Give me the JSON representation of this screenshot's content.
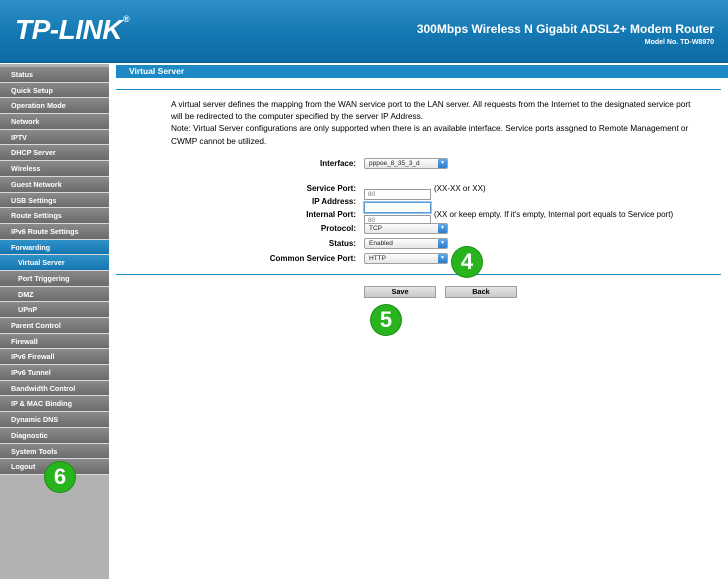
{
  "header": {
    "brand": "TP-LINK",
    "title": "300Mbps Wireless N Gigabit ADSL2+ Modem Router",
    "model": "Model No. TD-W8970"
  },
  "sidebar": {
    "items": [
      {
        "label": "Status"
      },
      {
        "label": "Quick Setup"
      },
      {
        "label": "Operation Mode"
      },
      {
        "label": "Network"
      },
      {
        "label": "IPTV"
      },
      {
        "label": "DHCP Server"
      },
      {
        "label": "Wireless"
      },
      {
        "label": "Guest Network"
      },
      {
        "label": "USB Settings"
      },
      {
        "label": "Route Settings"
      },
      {
        "label": "IPv6 Route Settings"
      },
      {
        "label": "Forwarding"
      },
      {
        "label": "Virtual Server"
      },
      {
        "label": "Port Triggering"
      },
      {
        "label": "DMZ"
      },
      {
        "label": "UPnP"
      },
      {
        "label": "Parent Control"
      },
      {
        "label": "Firewall"
      },
      {
        "label": "IPv6 Firewall"
      },
      {
        "label": "IPv6 Tunnel"
      },
      {
        "label": "Bandwidth Control"
      },
      {
        "label": "IP & MAC Binding"
      },
      {
        "label": "Dynamic DNS"
      },
      {
        "label": "Diagnostic"
      },
      {
        "label": "System Tools"
      },
      {
        "label": "Logout"
      }
    ]
  },
  "main": {
    "section_title": "Virtual Server",
    "desc_line1": "A virtual server defines the mapping from the WAN service port to the LAN server. All requests from the Internet to the designated service port will be redirected to the computer specified by the server IP Address.",
    "desc_line2": "Note: Virtual Server configurations are only supported when there is an available interface. Service ports assgned to Remote Management or CWMP cannot be utilized.",
    "form": {
      "interface_label": "Interface:",
      "interface_value": "pppoe_8_35_3_d",
      "service_port_label": "Service Port:",
      "service_port_value": "80",
      "service_port_hint": "(XX-XX or XX)",
      "ip_label": "IP Address:",
      "ip_value": "",
      "internal_port_label": "Internal Port:",
      "internal_port_value": "80",
      "internal_port_hint": "(XX or keep empty. If it's empty, Internal port equals to Service port)",
      "protocol_label": "Protocol:",
      "protocol_value": "TCP",
      "status_label": "Status:",
      "status_value": "Enabled",
      "common_label": "Common Service Port:",
      "common_value": "HTTP"
    },
    "buttons": {
      "save": "Save",
      "back": "Back"
    }
  },
  "badges": {
    "b4": "4",
    "b5": "5",
    "b6": "6"
  },
  "colors": {
    "accent": "#1d8ac6",
    "badge": "#27b41c"
  }
}
